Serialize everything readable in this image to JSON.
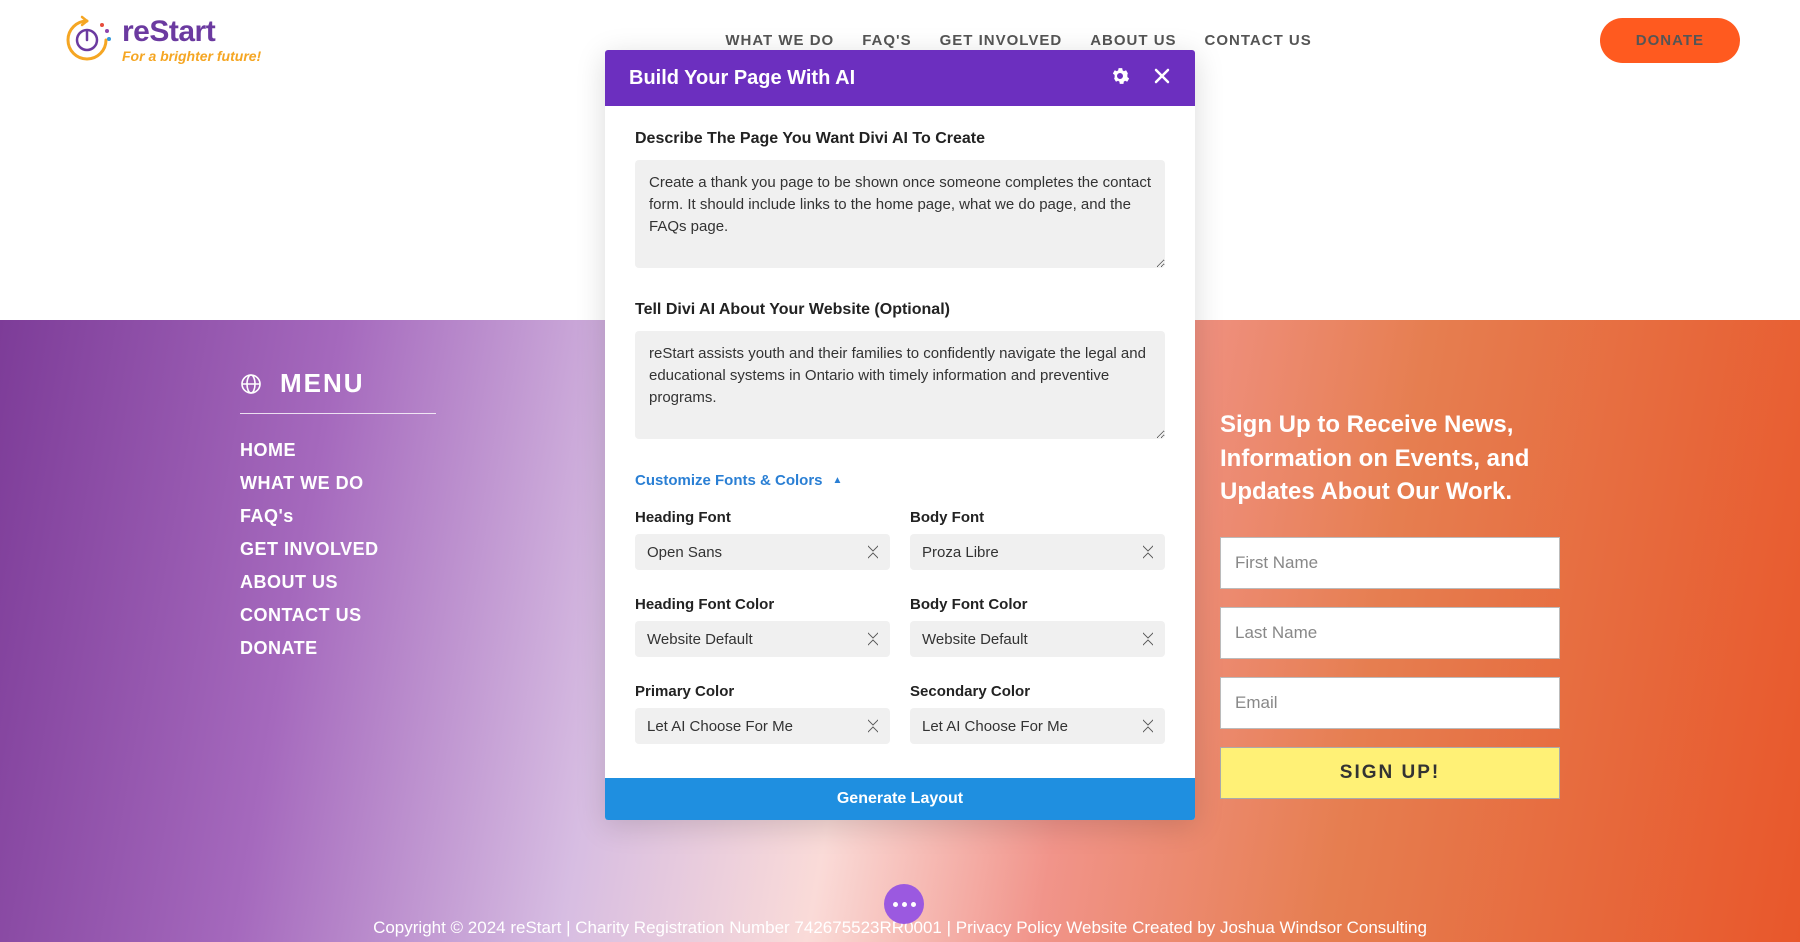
{
  "header": {
    "logo_main": "reStart",
    "logo_tag": "For a brighter future!",
    "nav": {
      "what_we_do": "WHAT WE DO",
      "faqs": "FAQ'S",
      "get_involved": "GET INVOLVED",
      "about_us": "ABOUT US",
      "contact_us": "CONTACT US"
    },
    "donate": "DONATE"
  },
  "modal": {
    "title": "Build Your Page With AI",
    "describe_label": "Describe The Page You Want Divi AI To Create",
    "describe_value": "Create a thank you page to be shown once someone completes the contact form. It should include links to the home page, what we do page, and the FAQs page.",
    "about_label": "Tell Divi AI About Your Website (Optional)",
    "about_value": "reStart assists youth and their families to confidently navigate the legal and educational systems in Ontario with timely information and preventive programs.",
    "customize_label": "Customize Fonts & Colors",
    "fields": {
      "heading_font": {
        "label": "Heading Font",
        "value": "Open Sans"
      },
      "body_font": {
        "label": "Body Font",
        "value": "Proza Libre"
      },
      "heading_color": {
        "label": "Heading Font Color",
        "value": "Website Default"
      },
      "body_color": {
        "label": "Body Font Color",
        "value": "Website Default"
      },
      "primary_color": {
        "label": "Primary Color",
        "value": "Let AI Choose For Me"
      },
      "secondary_color": {
        "label": "Secondary Color",
        "value": "Let AI Choose For Me"
      }
    },
    "generate": "Generate Layout"
  },
  "footer": {
    "menu_title": "MENU",
    "links": {
      "home": "HOME",
      "what_we_do": "WHAT WE DO",
      "faqs": "FAQ's",
      "get_involved": "GET INVOLVED",
      "about_us": "ABOUT US",
      "contact_us": "CONTACT US",
      "donate": "DONATE"
    },
    "signup_heading": "Sign Up to Receive News, Information on Events, and Updates About Our Work.",
    "placeholders": {
      "first_name": "First Name",
      "last_name": "Last Name",
      "email": "Email"
    },
    "signup_btn": "SIGN UP!",
    "copyright": "Copyright © 2024 reStart | Charity Registration Number 742675523RR0001 | Privacy Policy Website Created by Joshua Windsor Consulting"
  }
}
